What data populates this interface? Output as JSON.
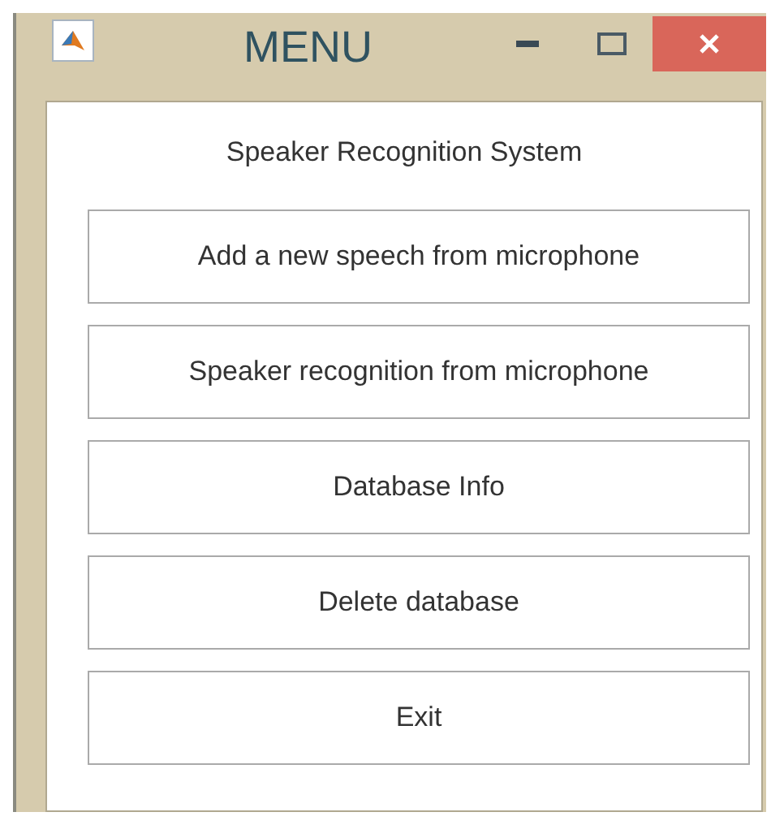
{
  "window": {
    "title": "MENU"
  },
  "heading": "Speaker Recognition System",
  "buttons": [
    {
      "label": "Add a new speech from microphone"
    },
    {
      "label": "Speaker recognition from microphone"
    },
    {
      "label": "Database Info"
    },
    {
      "label": "Delete database"
    },
    {
      "label": "Exit"
    }
  ]
}
